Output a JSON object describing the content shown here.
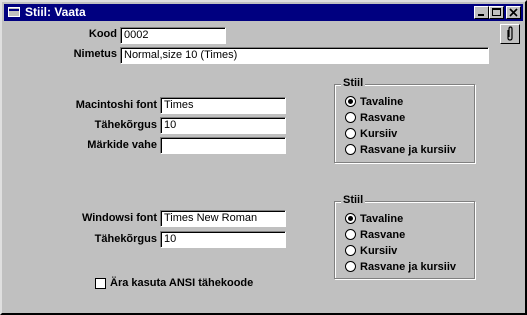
{
  "window": {
    "title": "Stiil: Vaata"
  },
  "code": {
    "label": "Kood",
    "value": "0002"
  },
  "name": {
    "label": "Nimetus",
    "value": "Normal,size 10 (Times)"
  },
  "mac": {
    "font_label": "Macintoshi font",
    "font_value": "Times",
    "size_label": "Tähekõrgus",
    "size_value": "10",
    "spacing_label": "Märkide vahe",
    "spacing_value": ""
  },
  "mac_style": {
    "title": "Stiil",
    "options": [
      "Tavaline",
      "Rasvane",
      "Kursiiv",
      "Rasvane ja kursiiv"
    ],
    "selected": "Tavaline"
  },
  "win": {
    "font_label": "Windowsi font",
    "font_value": "Times New Roman",
    "size_label": "Tähekõrgus",
    "size_value": "10"
  },
  "win_style": {
    "title": "Stiil",
    "options": [
      "Tavaline",
      "Rasvane",
      "Kursiiv",
      "Rasvane ja kursiiv"
    ],
    "selected": "Tavaline"
  },
  "ansi": {
    "label": "Ära kasuta ANSI tähekoode",
    "checked": false
  },
  "icons": {
    "attach": "paperclip-icon"
  }
}
